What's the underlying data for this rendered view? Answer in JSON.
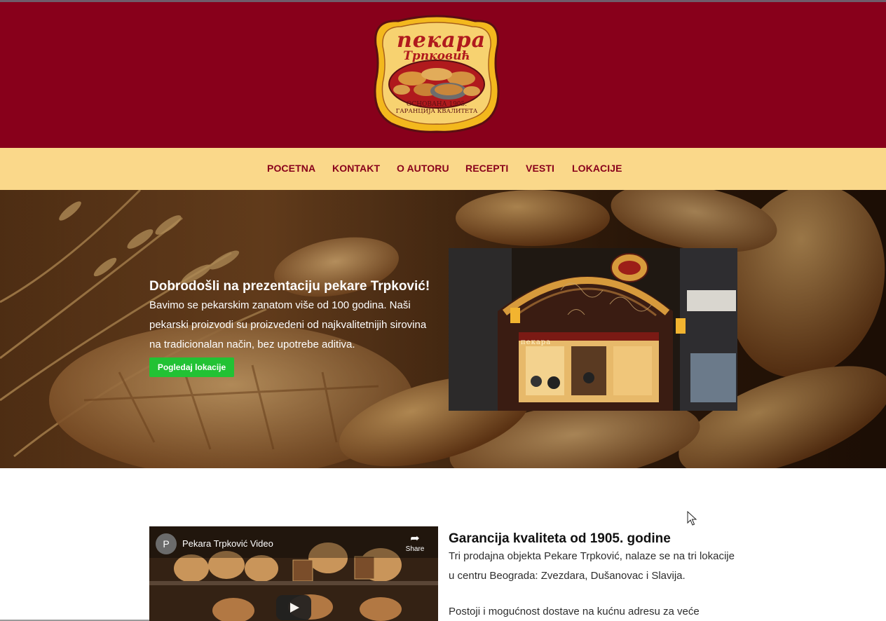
{
  "header": {
    "logo": {
      "line1": "пекара",
      "line2": "Трпковић",
      "line3": "ОСНОВАНА 1905.",
      "line4": "ГАРАНЦИЈА КВАЛИТЕТА"
    }
  },
  "nav": {
    "items": [
      {
        "label": "POCETNA"
      },
      {
        "label": "KONTAKT"
      },
      {
        "label": "O AUTORU"
      },
      {
        "label": "RECEPTI"
      },
      {
        "label": "VESTI"
      },
      {
        "label": "LOKACIJE"
      }
    ]
  },
  "hero": {
    "title": "Dobrodošli na prezentaciju pekare Trpković!",
    "text": "Bavimo se pekarskim zanatom više od 100 godina. Naši pekarski proizvodi su proizvedeni od najkvalitetnijih sirovina na tradicionalan način, bez upotrebe aditiva.",
    "button_label": "Pogledaj lokacije",
    "photo_sign": "пекара"
  },
  "section2": {
    "video": {
      "channel_initial": "P",
      "title": "Pekara Trpković Video",
      "share_label": "Share"
    },
    "title": "Garancija kvaliteta od 1905. godine",
    "paragraph1": "Tri prodajna objekta Pekare Trpković, nalaze se na tri lokacije u centru Beograda: Zvezdara, Dušanovac i Slavija.",
    "paragraph2": "Postoji i mogućnost dostave na kućnu adresu za veće"
  },
  "colors": {
    "header_bg": "#88001b",
    "nav_bg": "#fad88a",
    "nav_text": "#88001b",
    "button_bg": "#22c234"
  },
  "icons": [
    "share-icon",
    "play-icon",
    "mouse-cursor-icon"
  ]
}
